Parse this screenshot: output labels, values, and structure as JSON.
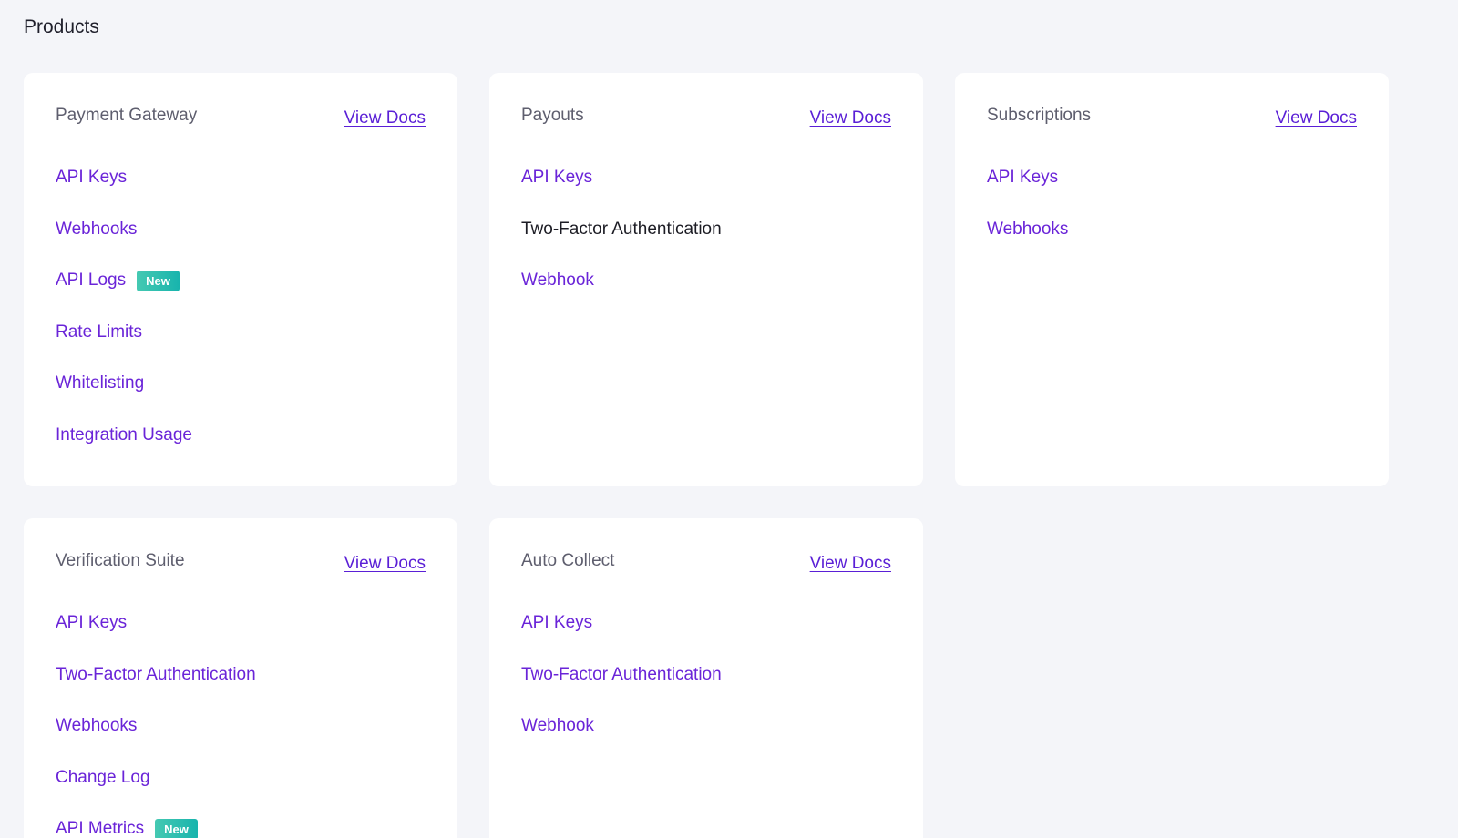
{
  "page": {
    "title": "Products"
  },
  "products": [
    {
      "title": "Payment Gateway",
      "docs_label": "View Docs",
      "links": [
        {
          "label": "API Keys",
          "badge": ""
        },
        {
          "label": "Webhooks",
          "badge": ""
        },
        {
          "label": "API Logs",
          "badge": "New"
        },
        {
          "label": "Rate Limits",
          "badge": ""
        },
        {
          "label": "Whitelisting",
          "badge": ""
        },
        {
          "label": "Integration Usage",
          "badge": ""
        }
      ]
    },
    {
      "title": "Payouts",
      "docs_label": "View Docs",
      "links": [
        {
          "label": "API Keys",
          "badge": ""
        },
        {
          "label": "Two-Factor Authentication",
          "badge": "",
          "plain": true
        },
        {
          "label": "Webhook",
          "badge": ""
        }
      ]
    },
    {
      "title": "Subscriptions",
      "docs_label": "View Docs",
      "links": [
        {
          "label": "API Keys",
          "badge": ""
        },
        {
          "label": "Webhooks",
          "badge": ""
        }
      ]
    },
    {
      "title": "Verification Suite",
      "docs_label": "View Docs",
      "links": [
        {
          "label": "API Keys",
          "badge": ""
        },
        {
          "label": "Two-Factor Authentication",
          "badge": ""
        },
        {
          "label": "Webhooks",
          "badge": ""
        },
        {
          "label": "Change Log",
          "badge": ""
        },
        {
          "label": "API Metrics",
          "badge": "New"
        }
      ]
    },
    {
      "title": "Auto Collect",
      "docs_label": "View Docs",
      "links": [
        {
          "label": "API Keys",
          "badge": ""
        },
        {
          "label": "Two-Factor Authentication",
          "badge": ""
        },
        {
          "label": "Webhook",
          "badge": ""
        }
      ]
    }
  ],
  "colors": {
    "link": "#6a24d8",
    "docs_link": "#5a1fd6",
    "badge": "#18b4ad",
    "background": "#f4f5f9"
  }
}
